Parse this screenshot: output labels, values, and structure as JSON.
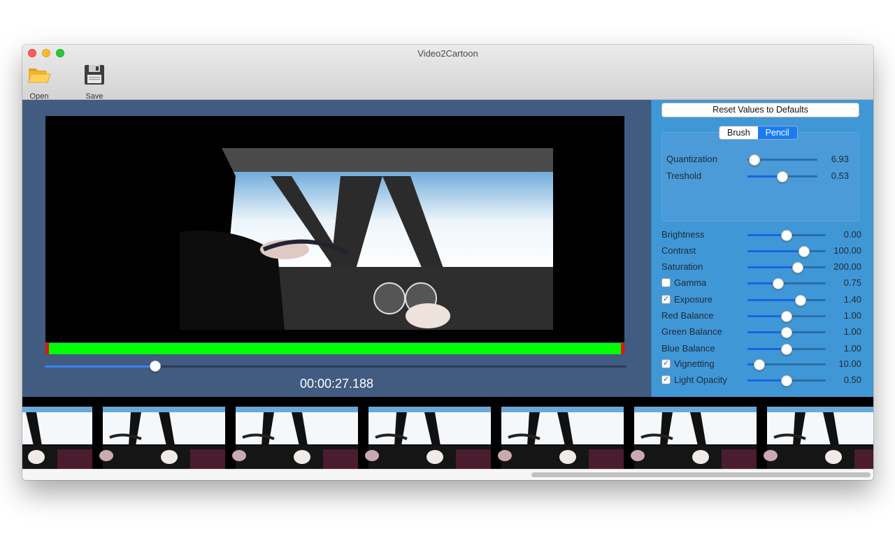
{
  "window": {
    "title": "Video2Cartoon"
  },
  "toolbar": {
    "open": {
      "label": "Open",
      "icon": "folder-open-icon"
    },
    "save": {
      "label": "Save",
      "icon": "floppy-disk-icon"
    }
  },
  "player": {
    "timecode": "00:00:27.188",
    "scrub_position": 0.19
  },
  "panel": {
    "reset_label": "Reset Values to Defaults",
    "mode_tabs": [
      "Brush",
      "Pencil"
    ],
    "selected_mode": "Pencil",
    "pencil_controls": [
      {
        "label": "Quantization",
        "value": "6.93",
        "level": 0.1
      },
      {
        "label": "Treshold",
        "value": "0.53",
        "level": 0.5
      }
    ],
    "controls": [
      {
        "label": "Brightness",
        "value": "0.00",
        "level": 0.5,
        "checkbox": null
      },
      {
        "label": "Contrast",
        "value": "100.00",
        "level": 0.72,
        "checkbox": null
      },
      {
        "label": "Saturation",
        "value": "200.00",
        "level": 0.64,
        "checkbox": null
      },
      {
        "label": "Gamma",
        "value": "0.75",
        "level": 0.39,
        "checkbox": false
      },
      {
        "label": "Exposure",
        "value": "1.40",
        "level": 0.68,
        "checkbox": true
      },
      {
        "label": "Red Balance",
        "value": "1.00",
        "level": 0.5,
        "checkbox": null
      },
      {
        "label": "Green Balance",
        "value": "1.00",
        "level": 0.5,
        "checkbox": null
      },
      {
        "label": "Blue Balance",
        "value": "1.00",
        "level": 0.5,
        "checkbox": null
      },
      {
        "label": "Vignetting",
        "value": "10.00",
        "level": 0.15,
        "checkbox": true
      },
      {
        "label": "Light Opacity",
        "value": "0.50",
        "level": 0.5,
        "checkbox": true
      }
    ]
  },
  "colors": {
    "video_pane_bg": "#425b80",
    "panel_bg": "#4097d6",
    "timeline_green": "#00ff00",
    "timeline_marker_red": "#e51212",
    "accent_blue": "#1a7cf5"
  }
}
